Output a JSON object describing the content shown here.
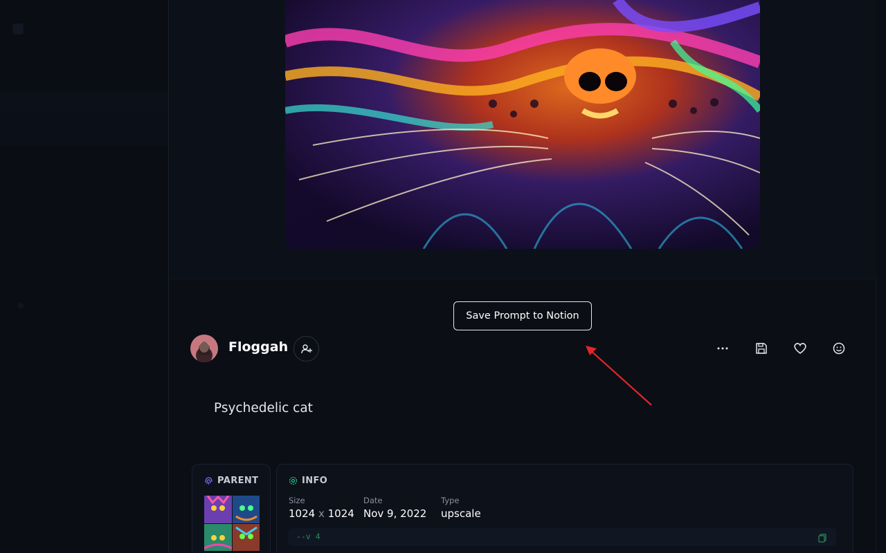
{
  "post": {
    "save_to_notion_label": "Save Prompt to Notion",
    "username": "Floggah",
    "prompt": "Psychedelic cat"
  },
  "actions": {
    "icons": [
      "more-icon",
      "save-icon",
      "heart-icon",
      "emoji-icon"
    ]
  },
  "parent": {
    "title": "PARENT"
  },
  "info": {
    "title": "INFO",
    "size_label": "Size",
    "size_w": "1024",
    "size_x": "x",
    "size_h": "1024",
    "date_label": "Date",
    "date_value": "Nov 9, 2022",
    "type_label": "Type",
    "type_value": "upscale",
    "params": "--v 4"
  },
  "colors": {
    "background": "#0b0e15",
    "annotation_arrow": "#e0262a",
    "parent_icon": "#7b6cf6",
    "info_icon": "#22c38e"
  }
}
